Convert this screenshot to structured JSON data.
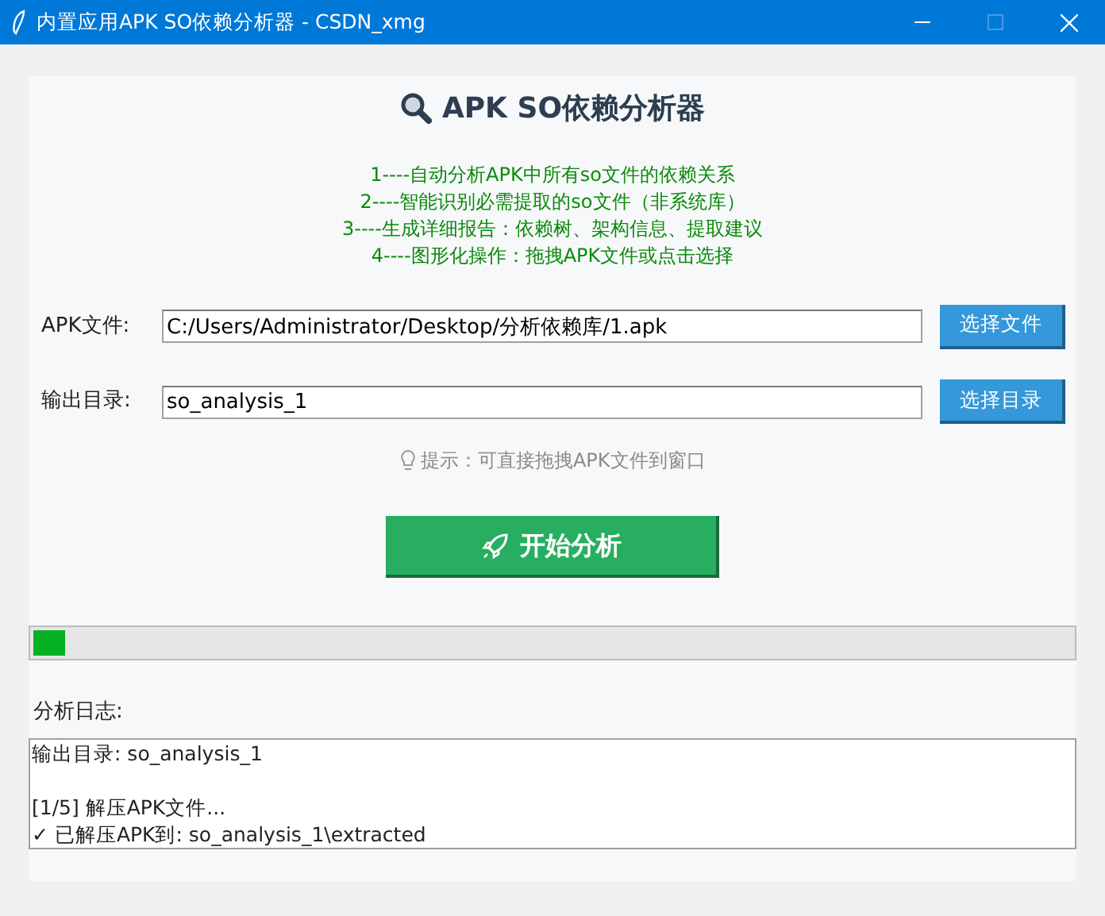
{
  "window": {
    "title": "内置应用APK SO依赖分析器 - CSDN_xmg"
  },
  "heading": "APK SO依赖分析器",
  "features": [
    "1----自动分析APK中所有so文件的依赖关系",
    "2----智能识别必需提取的so文件（非系统库）",
    "3----生成详细报告：依赖树、架构信息、提取建议",
    "4----图形化操作：拖拽APK文件或点击选择"
  ],
  "fields": [
    {
      "label": "APK文件:",
      "value": "C:/Users/Administrator/Desktop/分析依赖库/1.apk",
      "button": "选择文件"
    },
    {
      "label": "输出目录:",
      "value": "so_analysis_1",
      "button": "选择目录"
    }
  ],
  "hint": "提示：可直接拖拽APK文件到窗口",
  "start_button": "开始分析",
  "progress": {
    "level": 0.03
  },
  "log": {
    "label": "分析日志:",
    "groups": [
      [
        "输出目录: so_analysis_1"
      ],
      [
        "[1/5] 解压APK文件...",
        "✓ 已解压APK到: so_analysis_1\\extracted"
      ]
    ]
  }
}
